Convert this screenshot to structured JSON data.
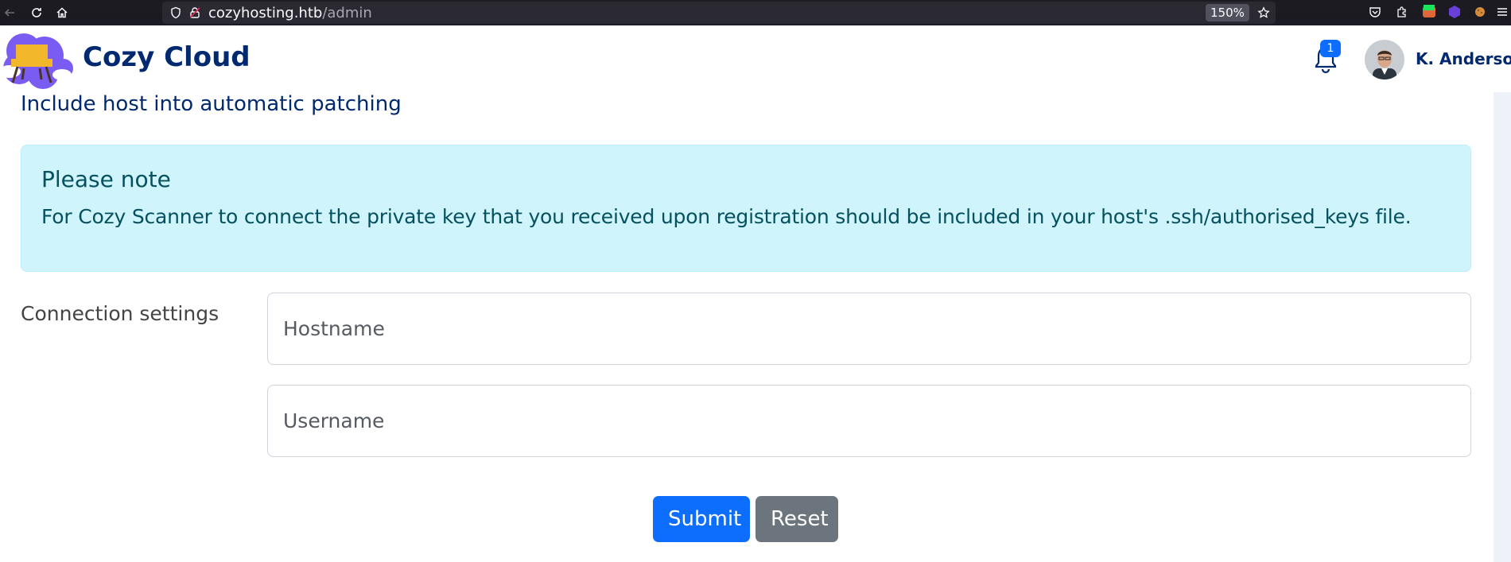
{
  "browser": {
    "url_host": "cozyhosting.htb",
    "url_path": "/admin",
    "zoom": "150%",
    "icons": [
      "back-arrow-icon",
      "reload-icon",
      "home-icon",
      "shield-icon",
      "lock-icon",
      "star-icon",
      "pocket-icon",
      "extensions-icon",
      "menu-icon"
    ]
  },
  "header": {
    "brand": "Cozy Cloud",
    "notification_count": "1",
    "user_name": "K. Anderson"
  },
  "main": {
    "section_title": "Include host into automatic patching",
    "alert": {
      "heading": "Please note",
      "text": "For Cozy Scanner to connect the private key that you received upon registration should be included in your host's .ssh/authorised_keys file."
    },
    "form": {
      "label": "Connection settings",
      "hostname_placeholder": "Hostname",
      "username_placeholder": "Username",
      "submit_label": "Submit",
      "reset_label": "Reset"
    }
  },
  "colors": {
    "accent": "#0d6efd",
    "brand_text": "#012970",
    "alert_bg": "#cff4fc",
    "alert_text": "#055160",
    "reset": "#6c757d"
  }
}
